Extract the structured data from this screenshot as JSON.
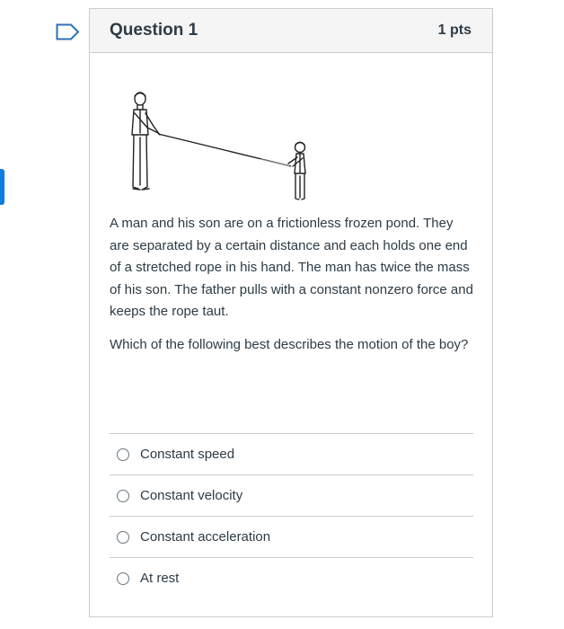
{
  "question": {
    "title": "Question 1",
    "points": "1 pts",
    "paragraphs": [
      "A man and his son are on a frictionless frozen pond. They are separated by a certain distance and each holds one end of a stretched rope in his hand. The man has twice the mass of his son. The father pulls with a constant nonzero force and keeps the rope taut.",
      "Which of the following best describes the motion of the boy?"
    ],
    "answers": [
      {
        "label": "Constant speed"
      },
      {
        "label": "Constant velocity"
      },
      {
        "label": "Constant acceleration"
      },
      {
        "label": "At rest"
      }
    ]
  },
  "colors": {
    "accent": "#0a7ce2",
    "border": "#c7cdd1",
    "text": "#2d3b45",
    "header_bg": "#f5f5f5"
  },
  "icons": {
    "flag": "bookmark-flag-icon"
  }
}
